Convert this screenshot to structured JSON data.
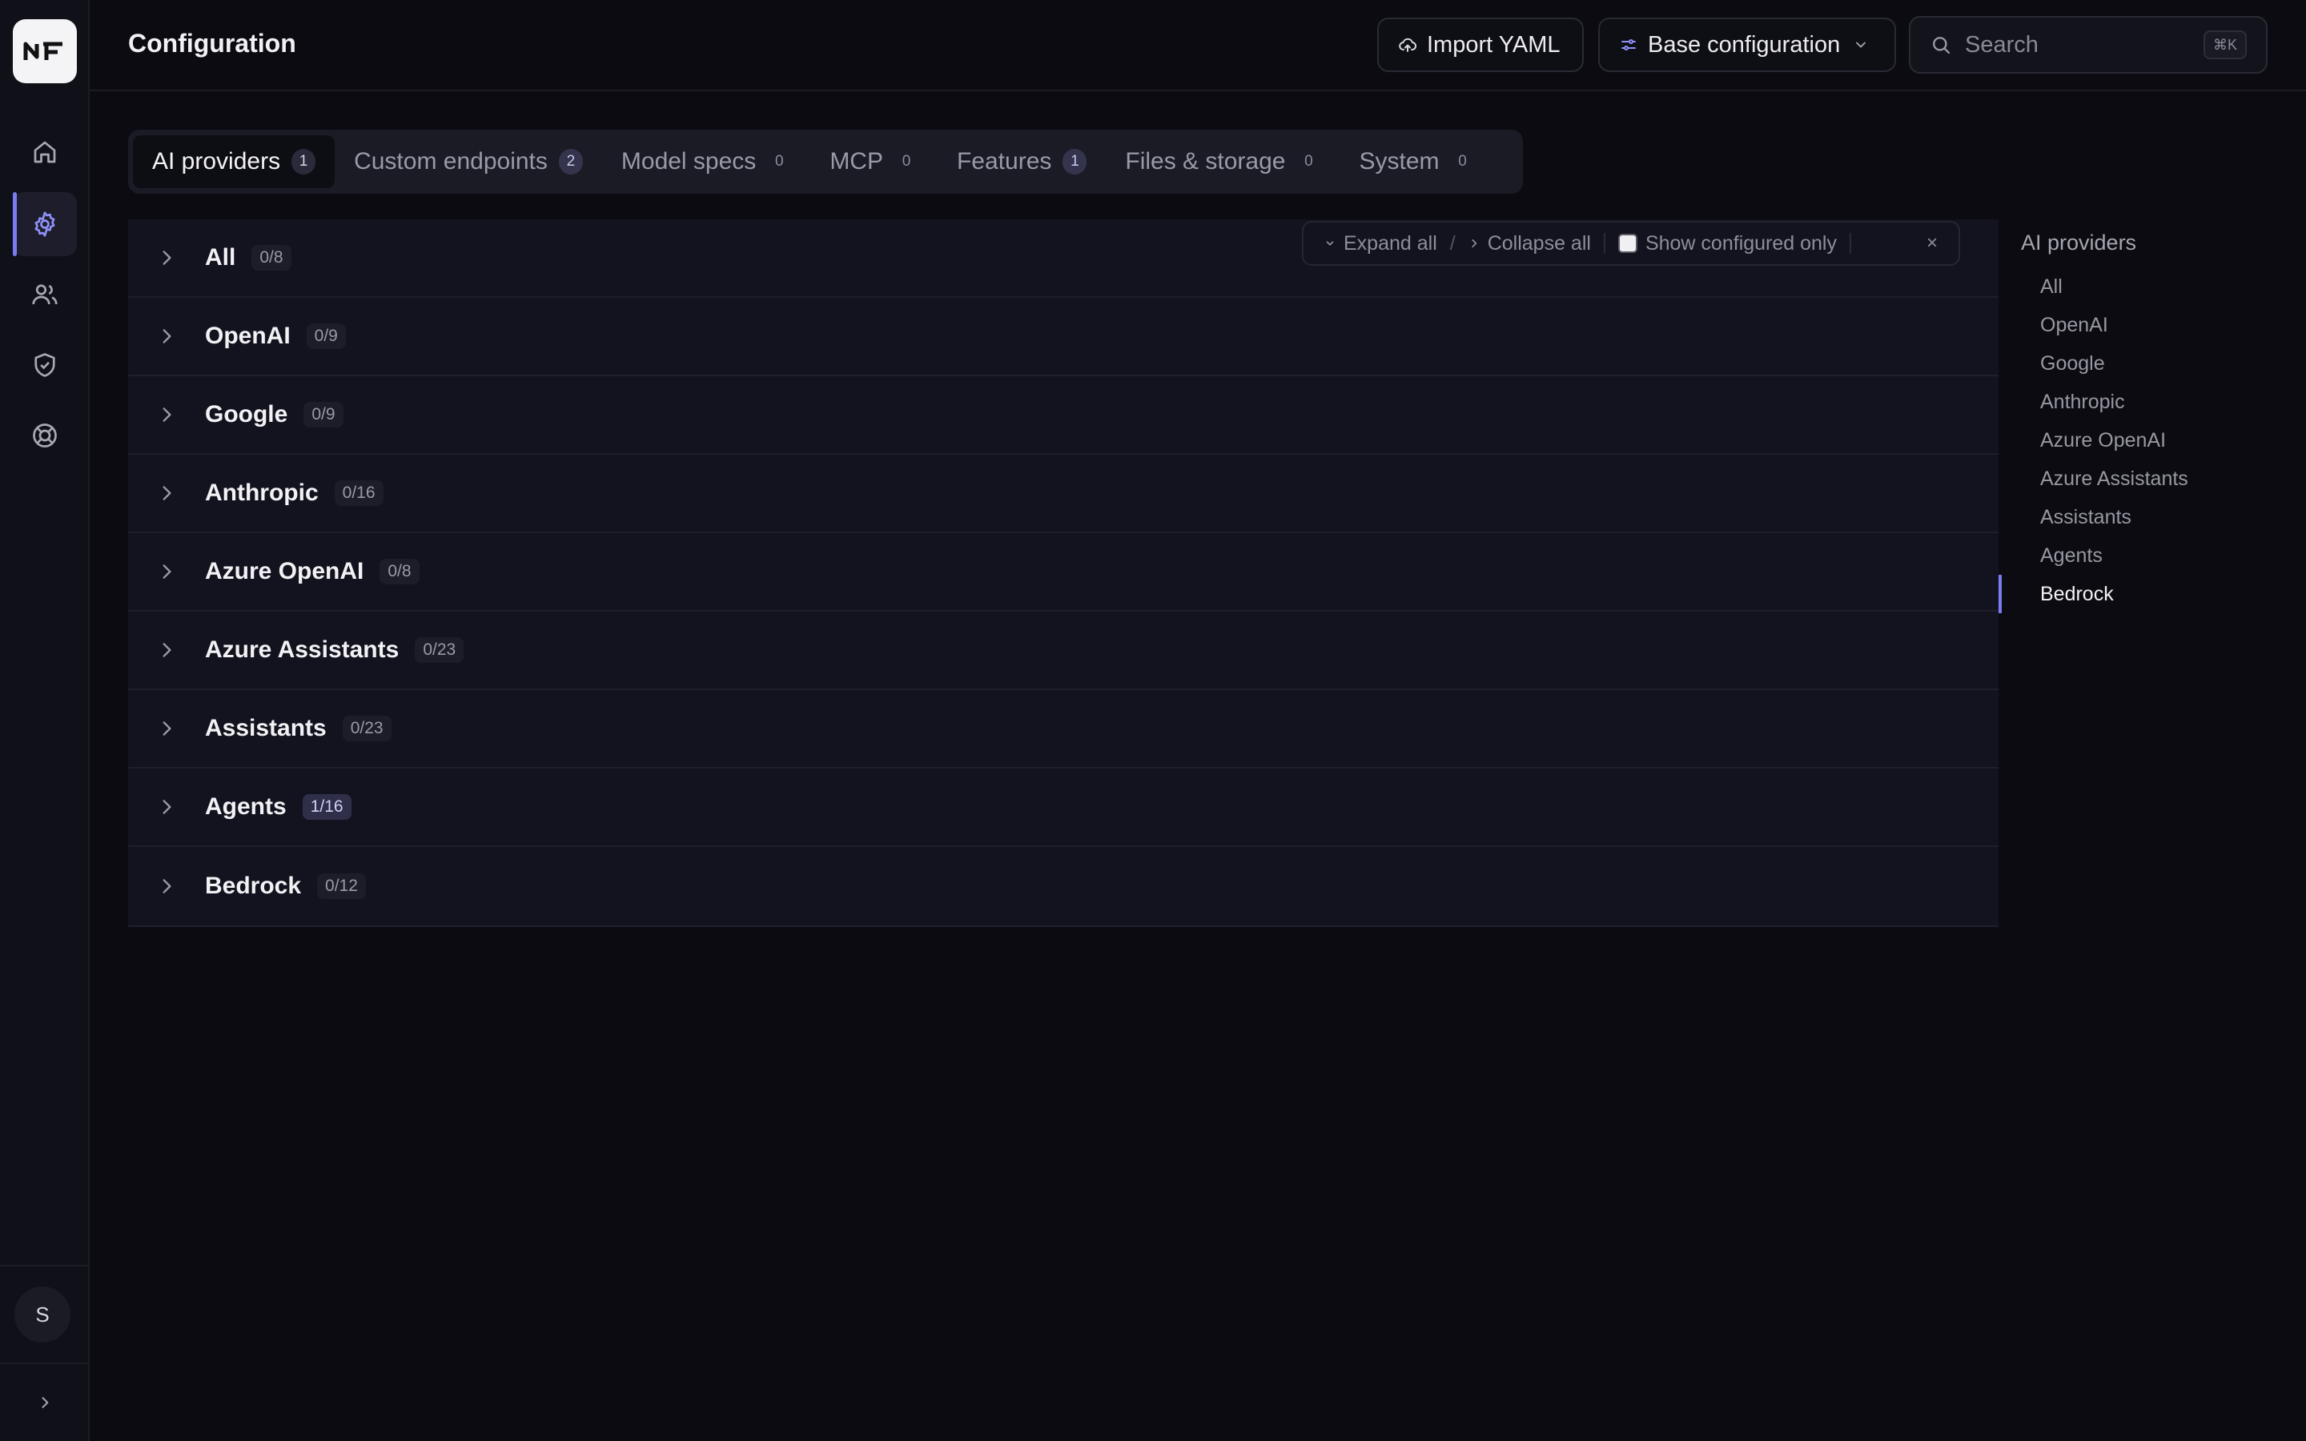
{
  "header": {
    "title": "Configuration",
    "import_label": "Import YAML",
    "config_label": "Base configuration",
    "search_placeholder": "Search",
    "search_shortcut": "⌘K"
  },
  "rail": {
    "logo_text": "NF",
    "items": [
      {
        "name": "home-icon",
        "active": false
      },
      {
        "name": "gear-icon",
        "active": true
      },
      {
        "name": "users-icon",
        "active": false
      },
      {
        "name": "shield-check-icon",
        "active": false
      },
      {
        "name": "lifebuoy-icon",
        "active": false
      }
    ],
    "avatar_initial": "S",
    "accent_color": "#7a7cf4"
  },
  "tabs": [
    {
      "label": "AI providers",
      "count": "1",
      "active": true,
      "highlight": true
    },
    {
      "label": "Custom endpoints",
      "count": "2",
      "active": false,
      "highlight": true
    },
    {
      "label": "Model specs",
      "count": "0",
      "active": false,
      "highlight": false
    },
    {
      "label": "MCP",
      "count": "0",
      "active": false,
      "highlight": false
    },
    {
      "label": "Features",
      "count": "1",
      "active": false,
      "highlight": true
    },
    {
      "label": "Files & storage",
      "count": "0",
      "active": false,
      "highlight": false
    },
    {
      "label": "System",
      "count": "0",
      "active": false,
      "highlight": false
    }
  ],
  "toolbar": {
    "expand_label": "Expand all",
    "separator": "/",
    "collapse_label": "Collapse all",
    "show_configured_label": "Show configured only",
    "show_configured_checked": false,
    "close_label": "×"
  },
  "providers": [
    {
      "label": "All",
      "count": "0/8",
      "highlight": false
    },
    {
      "label": "OpenAI",
      "count": "0/9",
      "highlight": false
    },
    {
      "label": "Google",
      "count": "0/9",
      "highlight": false
    },
    {
      "label": "Anthropic",
      "count": "0/16",
      "highlight": false
    },
    {
      "label": "Azure OpenAI",
      "count": "0/8",
      "highlight": false
    },
    {
      "label": "Azure Assistants",
      "count": "0/23",
      "highlight": false
    },
    {
      "label": "Assistants",
      "count": "0/23",
      "highlight": false
    },
    {
      "label": "Agents",
      "count": "1/16",
      "highlight": true
    },
    {
      "label": "Bedrock",
      "count": "0/12",
      "highlight": false
    }
  ],
  "right_nav": {
    "title": "AI providers",
    "items": [
      "All",
      "OpenAI",
      "Google",
      "Anthropic",
      "Azure OpenAI",
      "Azure Assistants",
      "Assistants",
      "Agents",
      "Bedrock"
    ],
    "active_item": "Bedrock"
  }
}
